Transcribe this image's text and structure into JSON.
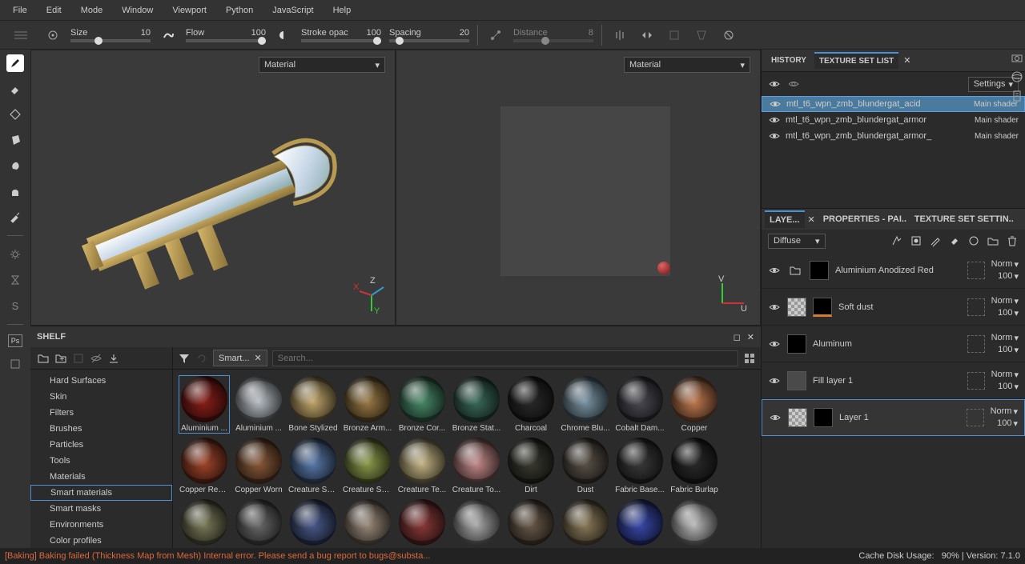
{
  "menu": [
    "File",
    "Edit",
    "Mode",
    "Window",
    "Viewport",
    "Python",
    "JavaScript",
    "Help"
  ],
  "toolbar": {
    "size": {
      "label": "Size",
      "value": "10",
      "pos": 30
    },
    "flow": {
      "label": "Flow",
      "value": "100",
      "pos": 90
    },
    "opac": {
      "label": "Stroke opac",
      "value": "100",
      "pos": 90
    },
    "spacing": {
      "label": "Spacing",
      "value": "20",
      "pos": 8
    },
    "distance": {
      "label": "Distance",
      "value": "8",
      "pos": 35
    }
  },
  "viewport": {
    "dropdown": "Material"
  },
  "topTabs": {
    "history": "HISTORY",
    "textureSet": "TEXTURE SET LIST"
  },
  "settingsLabel": "Settings",
  "textureSets": [
    {
      "name": "mtl_t6_wpn_zmb_blundergat_acid",
      "shader": "Main shader",
      "sel": true
    },
    {
      "name": "mtl_t6_wpn_zmb_blundergat_armor",
      "shader": "Main shader",
      "sel": false
    },
    {
      "name": "mtl_t6_wpn_zmb_blundergat_armor_",
      "shader": "Main shader",
      "sel": false
    }
  ],
  "layerTabs": {
    "layers": "LAYE...",
    "properties": "PROPERTIES - PAI...",
    "tss": "TEXTURE SET SETTIN..."
  },
  "channel": "Diffuse",
  "layers": [
    {
      "name": "Aluminium Anodized Red",
      "blend": "Norm",
      "opacity": "100",
      "folder": true
    },
    {
      "name": "Soft dust",
      "blend": "Norm",
      "opacity": "100",
      "checker": true,
      "orange": true
    },
    {
      "name": "Aluminum",
      "blend": "Norm",
      "opacity": "100"
    },
    {
      "name": "Fill layer 1",
      "blend": "Norm",
      "opacity": "100",
      "fill": true
    },
    {
      "name": "Layer 1",
      "blend": "Norm",
      "opacity": "100",
      "checker": true,
      "sel": true
    }
  ],
  "shelf": {
    "title": "SHELF",
    "chip": "Smart...",
    "searchPlaceholder": "Search...",
    "categories": [
      "Hard Surfaces",
      "Skin",
      "Filters",
      "Brushes",
      "Particles",
      "Tools",
      "Materials",
      "Smart materials",
      "Smart masks",
      "Environments",
      "Color profiles"
    ],
    "selectedCategory": "Smart materials",
    "materials": [
      {
        "n": "Aluminium ...",
        "c": "#8a1f1a",
        "sel": true
      },
      {
        "n": "Aluminium ...",
        "c": "#b8bfc5"
      },
      {
        "n": "Bone Stylized",
        "c": "#c2a76b"
      },
      {
        "n": "Bronze Arm...",
        "c": "#9a7a45"
      },
      {
        "n": "Bronze Cor...",
        "c": "#4a8a6a"
      },
      {
        "n": "Bronze Stat...",
        "c": "#3a6a5a"
      },
      {
        "n": "Charcoal",
        "c": "#2a2a2a"
      },
      {
        "n": "Chrome Blu...",
        "c": "#7a95a5"
      },
      {
        "n": "Cobalt Dam...",
        "c": "#4a4a52"
      },
      {
        "n": "Copper",
        "c": "#c07a50"
      },
      {
        "n": "Copper Red...",
        "c": "#a0452a"
      },
      {
        "n": "Copper Worn",
        "c": "#8a5a3a"
      },
      {
        "n": "Creature Ski...",
        "c": "#5a7aaa"
      },
      {
        "n": "Creature Ski...",
        "c": "#8a9a4a"
      },
      {
        "n": "Creature Te...",
        "c": "#c5b585"
      },
      {
        "n": "Creature To...",
        "c": "#c58a8a"
      },
      {
        "n": "Dirt",
        "c": "#3a3a32"
      },
      {
        "n": "Dust",
        "c": "#5a5248"
      },
      {
        "n": "Fabric Base...",
        "c": "#3a3a3a"
      },
      {
        "n": "Fabric Burlap",
        "c": "#2a2a2a"
      },
      {
        "n": "",
        "c": "#7a7a5a"
      },
      {
        "n": "",
        "c": "#6a6a6a"
      },
      {
        "n": "",
        "c": "#4a5a8a"
      },
      {
        "n": "",
        "c": "#9a8a7a"
      },
      {
        "n": "",
        "c": "#8a3a3a"
      },
      {
        "n": "",
        "c": "#aaa"
      },
      {
        "n": "",
        "c": "#6a5a4a"
      },
      {
        "n": "",
        "c": "#8a7a5a"
      },
      {
        "n": "",
        "c": "#3a4aaa"
      },
      {
        "n": "",
        "c": "#bababa"
      }
    ]
  },
  "status": {
    "error": "[Baking] Baking failed (Thickness Map from Mesh) Internal error. Please send a bug report to bugs@substa...",
    "cache": "Cache Disk Usage:",
    "cachePct": "90%",
    "version": "| Version: 7.1.0"
  }
}
